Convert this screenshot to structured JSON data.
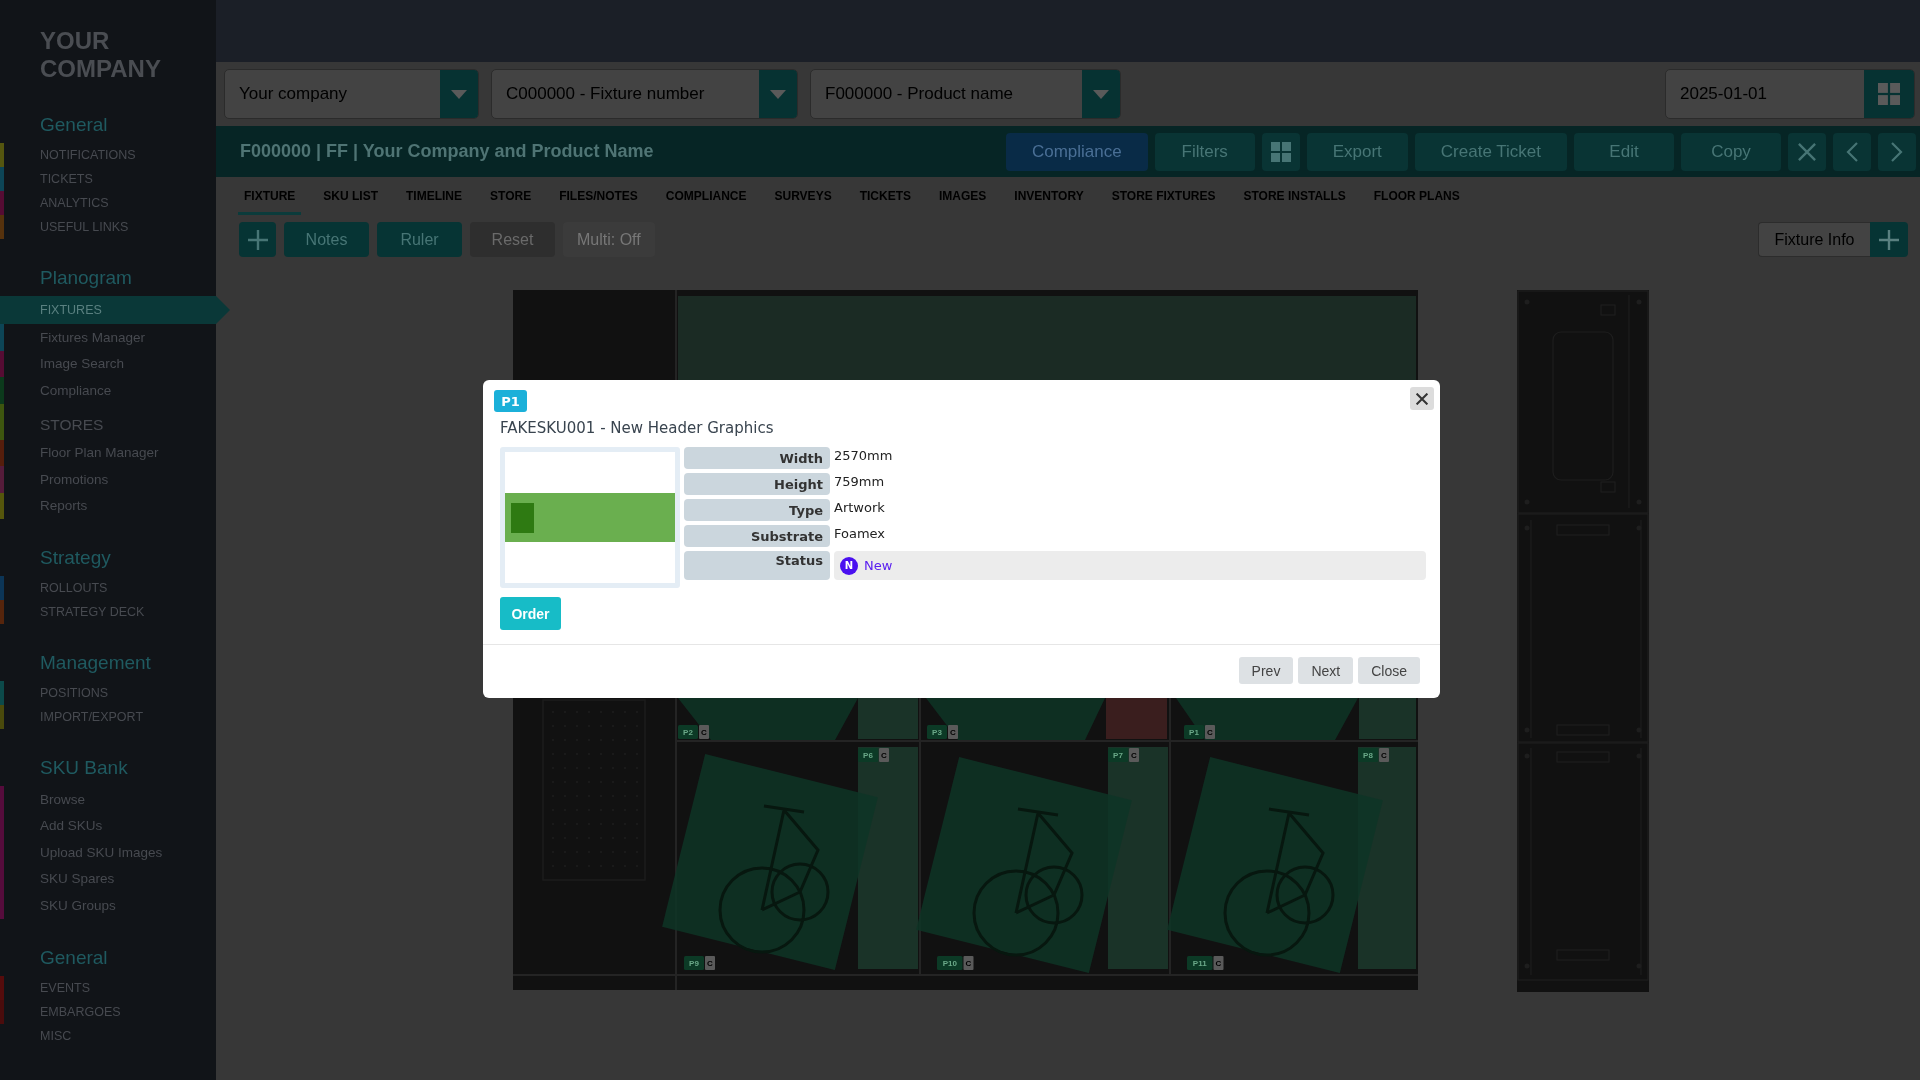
{
  "sidebar": {
    "logo": "YOUR COMPANY",
    "sections": [
      {
        "heading": "General",
        "items": [
          {
            "label": "NOTIFICATIONS",
            "kind": "main",
            "selected": false,
            "color": "#55560f"
          },
          {
            "label": "TICKETS",
            "kind": "main",
            "selected": false,
            "color": "#0d4556"
          },
          {
            "label": "ANALYTICS",
            "kind": "main",
            "selected": false,
            "color": "#560c33"
          },
          {
            "label": "USEFUL LINKS",
            "kind": "main",
            "selected": false,
            "color": "#56320d"
          }
        ]
      },
      {
        "heading": "Planogram",
        "items": [
          {
            "label": "FIXTURES",
            "kind": "main",
            "selected": true
          },
          {
            "label": "Fixtures Manager",
            "kind": "sub",
            "selected": false,
            "color": "#0d4556"
          },
          {
            "label": "Image Search",
            "kind": "sub",
            "selected": false,
            "color": "#560c33"
          },
          {
            "label": "Compliance",
            "kind": "sub",
            "selected": false,
            "color": "#0c3a1c"
          },
          {
            "label": "STORES",
            "kind": "group",
            "selected": false,
            "color": "#3e560f"
          },
          {
            "label": "Floor Plan Manager",
            "kind": "sub",
            "selected": false,
            "color": "#561e0c"
          },
          {
            "label": "Promotions",
            "kind": "sub",
            "selected": false,
            "color": "#561c3a"
          },
          {
            "label": "Reports",
            "kind": "sub",
            "selected": false,
            "color": "#56560c"
          }
        ]
      },
      {
        "heading": "Strategy",
        "items": [
          {
            "label": "ROLLOUTS",
            "kind": "main",
            "selected": false,
            "color": "#0c3556"
          },
          {
            "label": "STRATEGY DECK",
            "kind": "main",
            "selected": false,
            "color": "#56250c"
          }
        ]
      },
      {
        "heading": "Management",
        "items": [
          {
            "label": "POSITIONS",
            "kind": "main",
            "selected": false,
            "color": "#0c4a4a"
          },
          {
            "label": "IMPORT/EXPORT",
            "kind": "main",
            "selected": false,
            "color": "#4a4a0c"
          }
        ]
      },
      {
        "heading": "SKU Bank",
        "items": [
          {
            "label": "Browse",
            "kind": "sub",
            "selected": false,
            "color": "#560c3c"
          },
          {
            "label": "Add SKUs",
            "kind": "sub",
            "selected": false,
            "color": "#560c3c"
          },
          {
            "label": "Upload SKU Images",
            "kind": "sub",
            "selected": false,
            "color": "#560c3c"
          },
          {
            "label": "SKU Spares",
            "kind": "sub",
            "selected": false,
            "color": "#560c3c"
          },
          {
            "label": "SKU Groups",
            "kind": "sub",
            "selected": false,
            "color": "#560c3c"
          }
        ]
      },
      {
        "heading": "General",
        "items": [
          {
            "label": "EVENTS",
            "kind": "main",
            "selected": false,
            "color": "#560c0c"
          },
          {
            "label": "EMBARGOES",
            "kind": "main",
            "selected": false,
            "color": "#4a0c0c"
          },
          {
            "label": "MISC",
            "kind": "main",
            "selected": false
          }
        ]
      }
    ]
  },
  "filters": {
    "dropdowns": [
      {
        "value": "Your company"
      },
      {
        "value": "C000000 - Fixture number"
      },
      {
        "value": "F000000 - Product name"
      }
    ],
    "date": {
      "value": "2025-01-01"
    }
  },
  "title_bar": {
    "title": "F000000 | FF | Your Company and Product Name",
    "actions": [
      {
        "label": "Compliance",
        "kind": "primary"
      },
      {
        "label": "Filters",
        "kind": "plain"
      },
      {
        "kind": "grid"
      },
      {
        "label": "Export",
        "kind": "plain"
      },
      {
        "label": "Create Ticket",
        "kind": "plain"
      },
      {
        "label": "Edit",
        "kind": "plain"
      },
      {
        "label": "Copy",
        "kind": "plain"
      },
      {
        "kind": "close"
      },
      {
        "kind": "prev"
      },
      {
        "kind": "next"
      }
    ]
  },
  "tabs": [
    {
      "label": "FIXTURE",
      "selected": true
    },
    {
      "label": "SKU LIST",
      "selected": false
    },
    {
      "label": "TIMELINE",
      "selected": false
    },
    {
      "label": "STORE",
      "selected": false
    },
    {
      "label": "FILES/NOTES",
      "selected": false
    },
    {
      "label": "COMPLIANCE",
      "selected": false
    },
    {
      "label": "SURVEYS",
      "selected": false
    },
    {
      "label": "TICKETS",
      "selected": false
    },
    {
      "label": "IMAGES",
      "selected": false
    },
    {
      "label": "INVENTORY",
      "selected": false
    },
    {
      "label": "STORE FIXTURES",
      "selected": false
    },
    {
      "label": "STORE INSTALLS",
      "selected": false
    },
    {
      "label": "FLOOR PLANS",
      "selected": false
    }
  ],
  "toolbar": {
    "buttons": [
      {
        "kind": "add"
      },
      {
        "label": "Notes",
        "kind": "teal"
      },
      {
        "label": "Ruler",
        "kind": "teal"
      },
      {
        "label": "Reset",
        "kind": "secondary"
      },
      {
        "label": "Multi: Off",
        "kind": "toggle"
      }
    ],
    "fixture_info": {
      "label": "Fixture Info"
    }
  },
  "planogram": {
    "tags": [
      {
        "label": "P2",
        "flag": "C"
      },
      {
        "label": "P3",
        "flag": "C"
      },
      {
        "label": "P1",
        "flag": "C"
      },
      {
        "label": "P6",
        "flag": "C"
      },
      {
        "label": "P7",
        "flag": "C"
      },
      {
        "label": "P8",
        "flag": "C"
      },
      {
        "label": "P9",
        "flag": "C"
      },
      {
        "label": "P10",
        "flag": "C"
      },
      {
        "label": "P11",
        "flag": "C"
      }
    ]
  },
  "modal": {
    "badge": "P1",
    "title": "FAKESKU001 - New Header Graphics",
    "properties": [
      {
        "label": "Width",
        "value": "2570mm",
        "kind": "text"
      },
      {
        "label": "Height",
        "value": "759mm",
        "kind": "text"
      },
      {
        "label": "Type",
        "value": "Artwork",
        "kind": "text"
      },
      {
        "label": "Substrate",
        "value": "Foamex",
        "kind": "text"
      },
      {
        "label": "Status",
        "value": "New",
        "kind": "status",
        "badge": "N"
      }
    ],
    "order_button": "Order",
    "footer_buttons": [
      "Prev",
      "Next",
      "Close"
    ]
  }
}
